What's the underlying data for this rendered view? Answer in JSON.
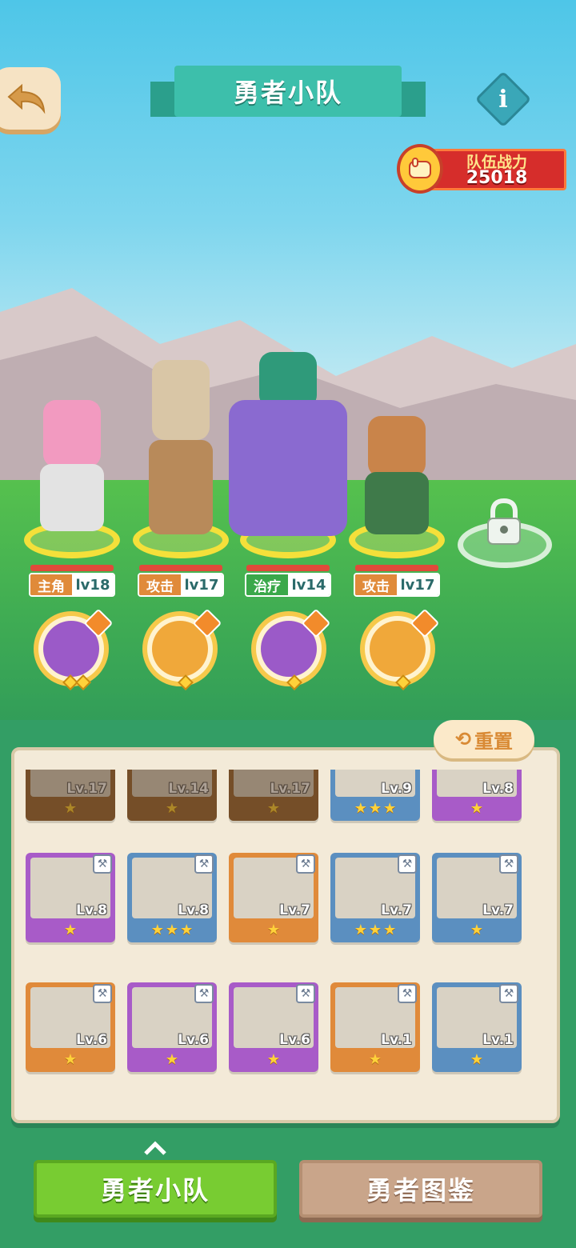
{
  "header": {
    "title": "勇者小队",
    "back_icon": "back-arrow-icon",
    "info_icon": "info-icon",
    "info_glyph": "i"
  },
  "team_power": {
    "label": "队伍战力",
    "value": "25018"
  },
  "heroes": [
    {
      "role": "主角",
      "level": "lv18",
      "role_color": "#e08a3a"
    },
    {
      "role": "攻击",
      "level": "lv17",
      "role_color": "#e08a3a"
    },
    {
      "role": "治疗",
      "level": "lv14",
      "role_color": "#3aa84a"
    },
    {
      "role": "攻击",
      "level": "lv17",
      "role_color": "#e08a3a"
    }
  ],
  "pets": [
    {
      "gems": 2
    },
    {
      "gems": 1
    },
    {
      "gems": 1
    },
    {
      "gems": 1
    }
  ],
  "roster": {
    "reset_label": "重置",
    "cards": [
      {
        "level": "Lv.17",
        "stars": 1,
        "rarity": "brown",
        "in_team": true
      },
      {
        "level": "Lv.14",
        "stars": 1,
        "rarity": "brown",
        "in_team": true
      },
      {
        "level": "Lv.17",
        "stars": 1,
        "rarity": "brown",
        "in_team": true
      },
      {
        "level": "Lv.9",
        "stars": 3,
        "rarity": "blue",
        "in_team": false
      },
      {
        "level": "Lv.8",
        "stars": 1,
        "rarity": "purple",
        "in_team": false
      },
      {
        "level": "Lv.8",
        "stars": 1,
        "rarity": "purple",
        "in_team": false
      },
      {
        "level": "Lv.8",
        "stars": 3,
        "rarity": "blue",
        "in_team": false
      },
      {
        "level": "Lv.7",
        "stars": 1,
        "rarity": "orange",
        "in_team": false
      },
      {
        "level": "Lv.7",
        "stars": 3,
        "rarity": "blue",
        "in_team": false
      },
      {
        "level": "Lv.7",
        "stars": 1,
        "rarity": "blue",
        "in_team": false
      },
      {
        "level": "Lv.6",
        "stars": 1,
        "rarity": "orange",
        "in_team": false
      },
      {
        "level": "Lv.6",
        "stars": 1,
        "rarity": "purple",
        "in_team": false
      },
      {
        "level": "Lv.6",
        "stars": 1,
        "rarity": "purple",
        "in_team": false
      },
      {
        "level": "Lv.1",
        "stars": 1,
        "rarity": "orange",
        "in_team": false
      },
      {
        "level": "Lv.1",
        "stars": 1,
        "rarity": "blue",
        "in_team": false
      }
    ]
  },
  "tabs": {
    "team_label": "勇者小队",
    "codex_label": "勇者图鉴",
    "active": "team"
  }
}
